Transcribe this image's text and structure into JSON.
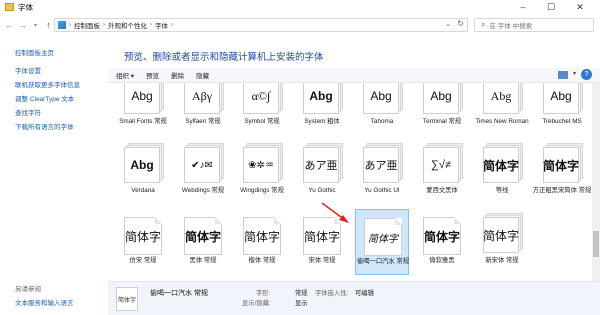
{
  "window": {
    "title": "字体"
  },
  "address": {
    "segments": [
      "控制面板",
      "外观和个性化",
      "字体"
    ]
  },
  "search": {
    "placeholder": "在 字体 中搜索"
  },
  "left_pane": {
    "home": "控制面板主页",
    "links": [
      "字体设置",
      "联机获取更多字体信息",
      "调整 ClearType 文本",
      "查找字符",
      "下载所有语言的字体"
    ],
    "see_also": "另请参阅",
    "see_also_links": [
      "文本服务和输入语言"
    ]
  },
  "heading": "预览、删除或者显示和隐藏计算机上安装的字体",
  "toolbar": {
    "organize": "组织 ▾",
    "preview": "预览",
    "delete": "删除",
    "hide": "隐藏"
  },
  "fonts": [
    {
      "name": "Small Fonts 常规",
      "preview": "Abg"
    },
    {
      "name": "Sylfaen 常规",
      "preview": "Aβγ"
    },
    {
      "name": "Symbol 常规",
      "preview": "α©∫"
    },
    {
      "name": "System 粗体",
      "preview": "Abg"
    },
    {
      "name": "Tahoma",
      "preview": "Abg"
    },
    {
      "name": "Terminal 常规",
      "preview": "Abg"
    },
    {
      "name": "Times New Roman",
      "preview": "Abg"
    },
    {
      "name": "Trebuchet MS",
      "preview": "Abg"
    },
    {
      "name": "Verdana",
      "preview": "Abg"
    },
    {
      "name": "Webdings 常规",
      "preview": "✔♪✉"
    },
    {
      "name": "Wingdings 常规",
      "preview": "❀✲♒"
    },
    {
      "name": "Yu Gothic",
      "preview": "あア亜"
    },
    {
      "name": "Yu Gothic UI",
      "preview": "あア亜"
    },
    {
      "name": "蒙西文黑体",
      "preview": "∑√≠"
    },
    {
      "name": "等线",
      "preview": "简体字"
    },
    {
      "name": "方正粗黑宋简体 常规",
      "preview": "简体字"
    },
    {
      "name": "仿宋 常规",
      "preview": "简体字"
    },
    {
      "name": "黑体 常规",
      "preview": "简体字"
    },
    {
      "name": "楷体 常规",
      "preview": "简体字"
    },
    {
      "name": "宋体 常规",
      "preview": "简体字"
    },
    {
      "name": "偷喝一口汽水 常规",
      "preview": "简体字"
    },
    {
      "name": "微软雅黑",
      "preview": "简体字"
    },
    {
      "name": "新宋体 常规",
      "preview": "简体字"
    }
  ],
  "details": {
    "name": "偷喝一口汽水 常规",
    "thumb": "简体字",
    "style_label": "字形:",
    "style_value": "常规",
    "show_hide_label": "显示/隐藏:",
    "show_hide_value": "显示",
    "embed_label": "字体嵌入性:",
    "embed_value": "可编辑"
  },
  "colors": {
    "link": "#1a5fb4",
    "heading": "#1e4a9e",
    "selection": "#cfe6fb",
    "arrow": "#e02020"
  }
}
